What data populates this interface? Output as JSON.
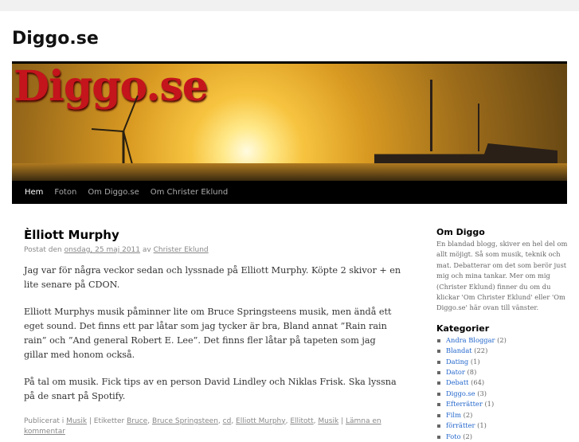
{
  "site": {
    "title": "Diggo.se",
    "logo_text": "Diggo.se"
  },
  "nav": [
    {
      "label": "Hem"
    },
    {
      "label": "Foton"
    },
    {
      "label": "Om Diggo.se"
    },
    {
      "label": "Om Christer Eklund"
    }
  ],
  "post": {
    "title": "Èlliott Murphy",
    "meta_prefix": "Postat den",
    "date": "onsdag, 25 maj 2011",
    "by": "av",
    "author": "Christer Eklund",
    "paragraphs": [
      "Jag var för några veckor sedan och lyssnade på Elliott Murphy. Köpte 2 skivor + en lite senare på CDON.",
      "Elliott Murphys musik påminner lite om Bruce Springsteens musik, men ändå ett eget sound. Det finns ett par låtar som jag tycker är bra, Bland annat ”Rain rain rain” och ”And general Robert E. Lee”. Det finns fler låtar på tapeten som jag gillar med honom också.",
      "På tal om musik. Fick tips av en person David Lindley och Niklas Frisk. Ska lyssna på de snart på Spotify."
    ],
    "footer": {
      "published_in": "Publicerat i",
      "category": "Musik",
      "tags_label": "| Etiketter",
      "tags": [
        "Bruce",
        "Bruce Springsteen",
        "cd",
        "Elliott Murphy",
        "Ellitott",
        "Musik"
      ],
      "comment": "Lämna en kommentar"
    }
  },
  "sidebar": {
    "about_title": "Om Diggo",
    "about_text": "En blandad blogg, skiver en hel del om allt möjigt. Så som musik, teknik och mat. Debatterar om det som berör just mig och mina tankar. Mer om mig (Christer Eklund) finner du om du klickar 'Om Christer Eklund' eller 'Om Diggo.se' här ovan till vänster.",
    "categories_title": "Kategorier",
    "categories": [
      {
        "name": "Andra Bloggar",
        "count": "(2)"
      },
      {
        "name": "Blandat",
        "count": "(22)"
      },
      {
        "name": "Dating",
        "count": "(1)"
      },
      {
        "name": "Dator",
        "count": "(8)"
      },
      {
        "name": "Debatt",
        "count": "(64)"
      },
      {
        "name": "Diggo.se",
        "count": "(3)"
      },
      {
        "name": "Efterrätter",
        "count": "(1)"
      },
      {
        "name": "Film",
        "count": "(2)"
      },
      {
        "name": "förrätter",
        "count": "(1)"
      },
      {
        "name": "Foto",
        "count": "(2)"
      }
    ]
  }
}
